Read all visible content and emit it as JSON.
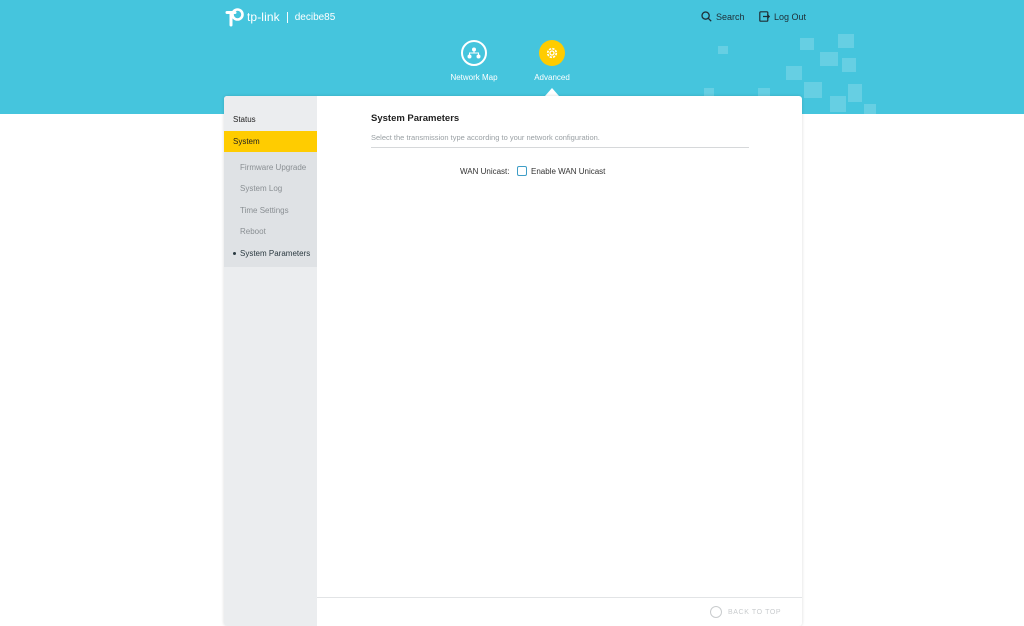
{
  "header": {
    "brand": "tp-link",
    "device_name": "decibe85",
    "search_label": "Search",
    "logout_label": "Log Out",
    "background_color": "#45c5dd"
  },
  "nav": {
    "items": [
      {
        "label": "Network Map",
        "icon": "network-map-icon",
        "active": false
      },
      {
        "label": "Advanced",
        "icon": "gear-icon",
        "active": true
      }
    ],
    "active_color": "#ffcc00"
  },
  "sidebar": {
    "items": [
      {
        "label": "Status",
        "active": false
      },
      {
        "label": "System",
        "active": true
      }
    ],
    "subitems": [
      {
        "label": "Firmware Upgrade",
        "current": false
      },
      {
        "label": "System Log",
        "current": false
      },
      {
        "label": "Time Settings",
        "current": false
      },
      {
        "label": "Reboot",
        "current": false
      },
      {
        "label": "System Parameters",
        "current": true
      }
    ]
  },
  "main": {
    "section_title": "System Parameters",
    "section_description": "Select the transmission type according to your network configuration.",
    "wan_unicast_label": "WAN Unicast:",
    "enable_wan_unicast_label": "Enable WAN Unicast",
    "enable_wan_unicast_checked": false
  },
  "footer": {
    "back_to_top_label": "BACK TO TOP"
  }
}
